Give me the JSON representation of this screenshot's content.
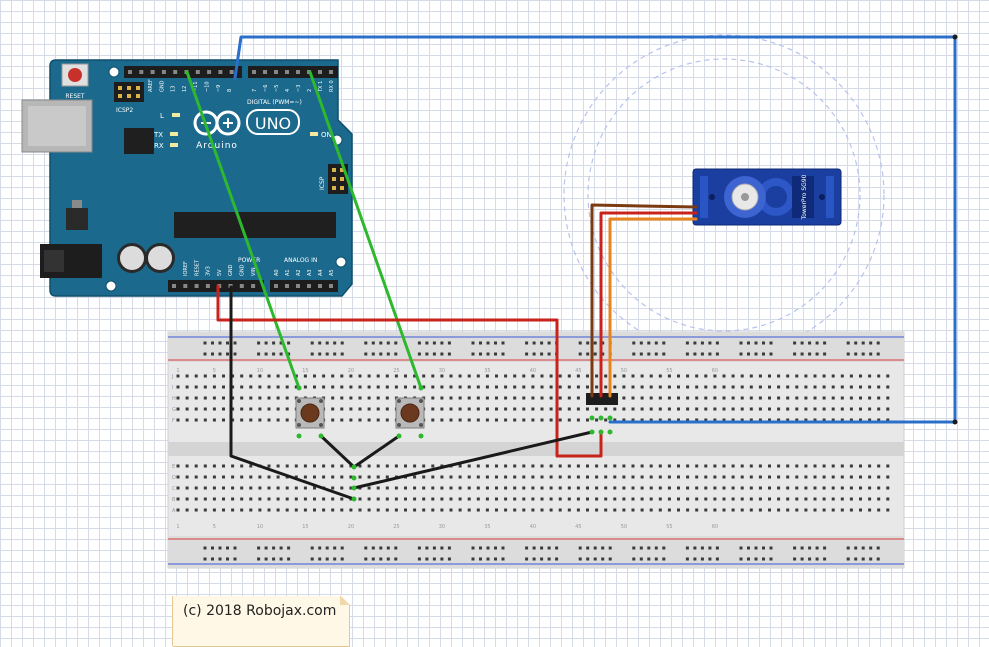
{
  "board": {
    "reset_label": "RESET",
    "icsp2_label": "ICSP2",
    "icsp_label": "ICSP",
    "l_label": "L",
    "tx_label": "TX",
    "rx_label": "RX",
    "on_label": "ON",
    "digital_label": "DIGITAL (PWM=~)",
    "power_label": "POWER",
    "analog_label": "ANALOG IN",
    "uno_label": "UNO",
    "brand_label": "Arduino",
    "aref_label": "AREF",
    "gnd_label": "GND",
    "power_pins": [
      "IOREF",
      "RESET",
      "3V3",
      "5V",
      "GND",
      "GND",
      "VIN"
    ],
    "analog_pins": [
      "A0",
      "A1",
      "A2",
      "A3",
      "A4",
      "A5"
    ],
    "digital_pins_left": [
      "13",
      "12",
      "~11",
      "~10",
      "~9",
      "8"
    ],
    "digital_pins_right": [
      "7",
      "~6",
      "~5",
      "4",
      "~3",
      "2",
      "TX 1",
      "RX 0"
    ]
  },
  "servo": {
    "label": "TowerPro SG90"
  },
  "breadboard": {
    "row_letters_top": [
      "J",
      "I",
      "H",
      "G",
      "F"
    ],
    "row_letters_bottom": [
      "E",
      "D",
      "C",
      "B",
      "A"
    ],
    "column_numbers": [
      "1",
      "5",
      "10",
      "15",
      "20",
      "25",
      "30",
      "35",
      "40",
      "45",
      "50",
      "55",
      "60"
    ]
  },
  "note": {
    "text": "(c) 2018 Robojax.com"
  },
  "colors": {
    "board": "#1b6a8d",
    "wire_green": "#2eb82e",
    "wire_black": "#1a1a1a",
    "wire_red": "#c8231b",
    "wire_blue": "#2a6fc9",
    "wire_brown": "#7a3b12",
    "wire_orange": "#e8841d",
    "servo_body": "#1a3fa0"
  }
}
